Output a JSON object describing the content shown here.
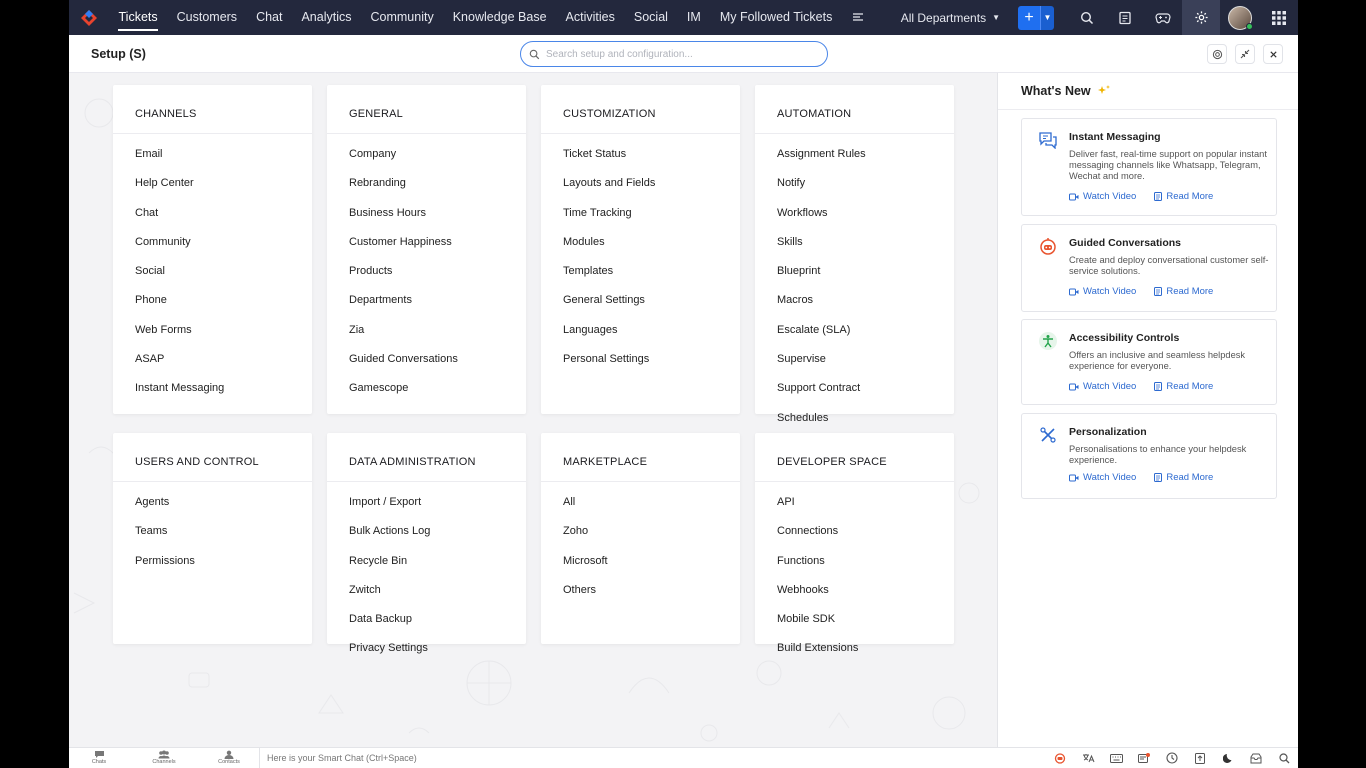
{
  "topbar": {
    "nav": [
      "Tickets",
      "Customers",
      "Chat",
      "Analytics",
      "Community",
      "Knowledge Base",
      "Activities",
      "Social",
      "IM",
      "My Followed Tickets"
    ],
    "active_nav": "Tickets",
    "department": "All Departments",
    "add_label": "+"
  },
  "setup": {
    "title": "Setup (S)",
    "search_placeholder": "Search setup and configuration..."
  },
  "sections": [
    {
      "title": "CHANNELS",
      "items": [
        "Email",
        "Help Center",
        "Chat",
        "Community",
        "Social",
        "Phone",
        "Web Forms",
        "ASAP",
        "Instant Messaging"
      ]
    },
    {
      "title": "GENERAL",
      "items": [
        "Company",
        "Rebranding",
        "Business Hours",
        "Customer Happiness",
        "Products",
        "Departments",
        "Zia",
        "Guided Conversations",
        "Gamescope"
      ]
    },
    {
      "title": "CUSTOMIZATION",
      "items": [
        "Ticket Status",
        "Layouts and Fields",
        "Time Tracking",
        "Modules",
        "Templates",
        "General Settings",
        "Languages",
        "Personal Settings"
      ]
    },
    {
      "title": "AUTOMATION",
      "items": [
        "Assignment Rules",
        "Notify",
        "Workflows",
        "Skills",
        "Blueprint",
        "Macros",
        "Escalate (SLA)",
        "Supervise",
        "Support Contract",
        "Schedules"
      ]
    },
    {
      "title": "USERS AND CONTROL",
      "items": [
        "Agents",
        "Teams",
        "Permissions"
      ]
    },
    {
      "title": "DATA ADMINISTRATION",
      "items": [
        "Import / Export",
        "Bulk Actions Log",
        "Recycle Bin",
        "Zwitch",
        "Data Backup",
        "Privacy Settings"
      ]
    },
    {
      "title": "MARKETPLACE",
      "items": [
        "All",
        "Zoho",
        "Microsoft",
        "Others"
      ]
    },
    {
      "title": "DEVELOPER SPACE",
      "items": [
        "API",
        "Connections",
        "Functions",
        "Webhooks",
        "Mobile SDK",
        "Build Extensions"
      ]
    }
  ],
  "whats_new": {
    "title": "What's New",
    "items": [
      {
        "icon": "chat-bubbles-icon",
        "title": "Instant Messaging",
        "desc": "Deliver fast, real-time support on popular instant messaging channels like Whatsapp, Telegram, Wechat and more.",
        "watch": "Watch Video",
        "read": "Read More"
      },
      {
        "icon": "bot-icon",
        "title": "Guided Conversations",
        "desc": "Create and deploy conversational customer self-service solutions.",
        "watch": "Watch Video",
        "read": "Read More"
      },
      {
        "icon": "accessibility-icon",
        "title": "Accessibility Controls",
        "desc": "Offers an inclusive and seamless helpdesk experience for everyone.",
        "watch": "Watch Video",
        "read": "Read More"
      },
      {
        "icon": "personalization-icon",
        "title": "Personalization",
        "desc": "Personalisations to enhance your helpdesk experience.",
        "watch": "Watch Video",
        "read": "Read More"
      }
    ]
  },
  "bottombar": {
    "tabs": [
      "Chats",
      "Channels",
      "Contacts"
    ],
    "smart_chat": "Here is your Smart Chat (Ctrl+Space)"
  },
  "colors": {
    "topbar": "#23283d",
    "accent": "#1f6ff0",
    "link": "#2d6ad0"
  }
}
